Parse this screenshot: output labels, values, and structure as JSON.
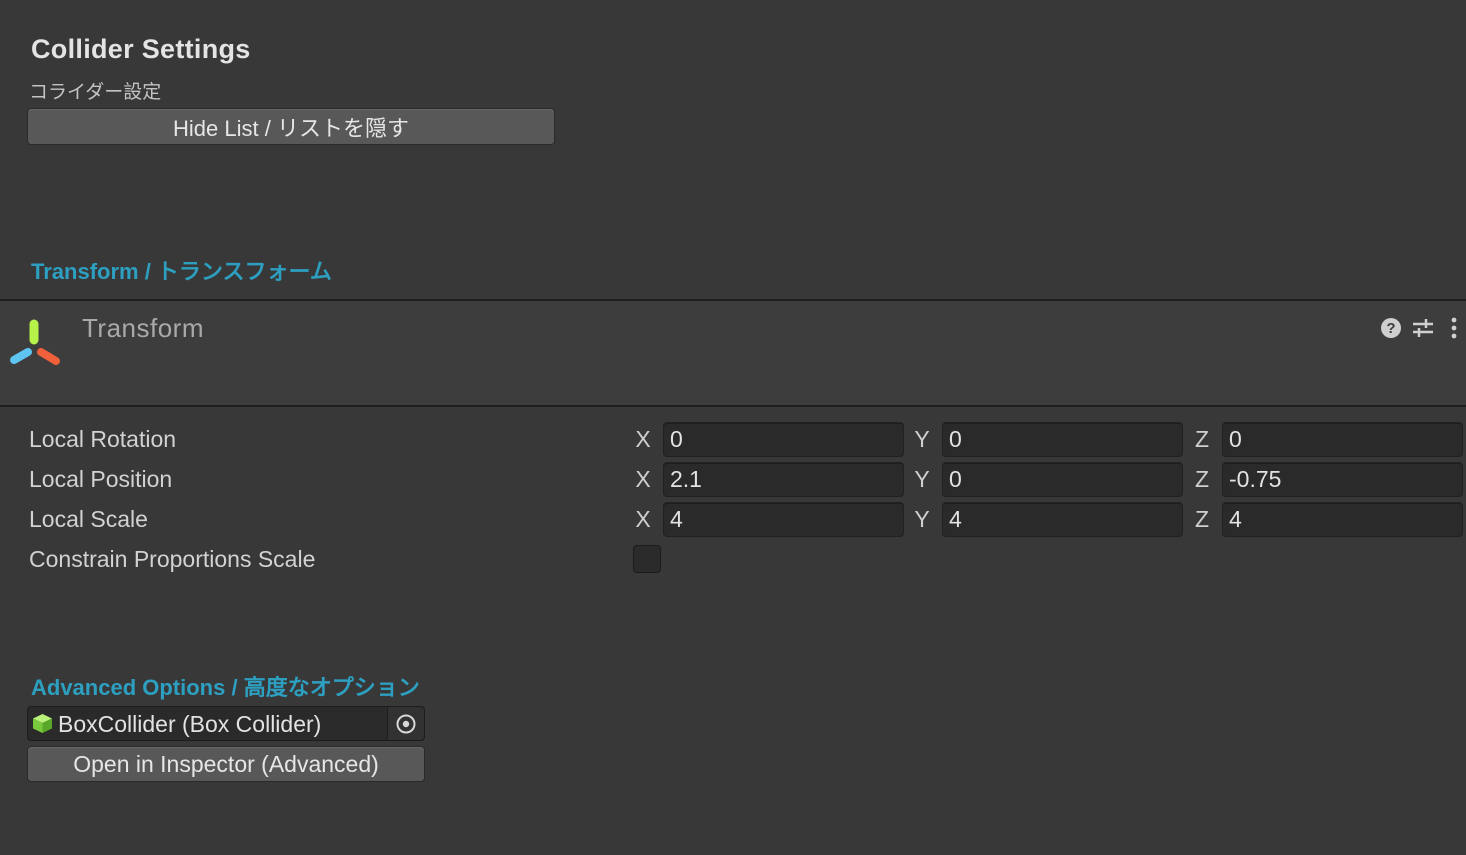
{
  "header": {
    "title": "Collider Settings",
    "subtitle": "コライダー設定",
    "hide_list_label": "Hide List / リストを隠す"
  },
  "transform_section": {
    "header": "Transform / トランスフォーム",
    "component_title": "Transform",
    "icons": [
      "transform-icon",
      "help-icon",
      "presets-icon",
      "more-icon"
    ],
    "rows": [
      {
        "label": "Local Rotation",
        "x": "0",
        "y": "0",
        "z": "0"
      },
      {
        "label": "Local Position",
        "x": "2.1",
        "y": "0",
        "z": "-0.75"
      },
      {
        "label": "Local Scale",
        "x": "4",
        "y": "4",
        "z": "4"
      }
    ],
    "axis_labels": {
      "x": "X",
      "y": "Y",
      "z": "Z"
    },
    "constrain_label": "Constrain Proportions Scale",
    "constrain_checked": false
  },
  "advanced_section": {
    "header": "Advanced Options / 高度なオプション",
    "object_field_value": "BoxCollider (Box Collider)",
    "object_icon": "box-collider-icon",
    "open_button_label": "Open in Inspector (Advanced)"
  },
  "colors": {
    "background": "#383838",
    "accent": "#2d9fc0",
    "field_bg": "#2a2a2a",
    "button_bg": "#585858"
  }
}
